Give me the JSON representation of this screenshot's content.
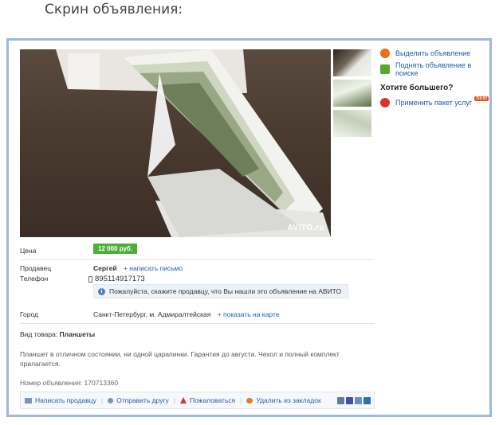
{
  "caption": "Скрин объявления:",
  "photo": {
    "watermark": "AVITO.ru"
  },
  "sidebar": {
    "highlight_label": "Выделить объявление",
    "raise_label": "Поднять объявление в поиске",
    "more_title": "Хотите большего?",
    "package_label": "Применить пакет услуг",
    "new_badge": "NEW"
  },
  "details": {
    "price_label": "Цена",
    "price_value": "12 000 руб.",
    "seller_label": "Продавец",
    "seller_name": "Сергей",
    "write_link": "+ написать письмо",
    "phone_label": "Телефон",
    "phone_value": "895114917173",
    "notice": "Пожалуйста, скажите продавцу, что Вы нашли это объявление на АВИТО",
    "city_label": "Город",
    "city_value": "Санкт-Петербург, м. Адмиралтейская",
    "map_link": "+ показать на карте",
    "type_label": "Вид товара:",
    "type_value": "Планшеты",
    "description": "Планшет в отличном состоянии, ни одной царапинки. Гарантия до августа. Чехол и полный комплект прилагается.",
    "ad_number": "Номер объявления: 170713360"
  },
  "actions": {
    "write_seller": "Написать продавцу",
    "send_friend": "Отправить другу",
    "complain": "Пожаловаться",
    "remove_bookmark": "Удалить из закладок"
  },
  "colors": {
    "frame": "#9fb8dc",
    "price_bg": "#4caf38",
    "link": "#1c5fae"
  }
}
